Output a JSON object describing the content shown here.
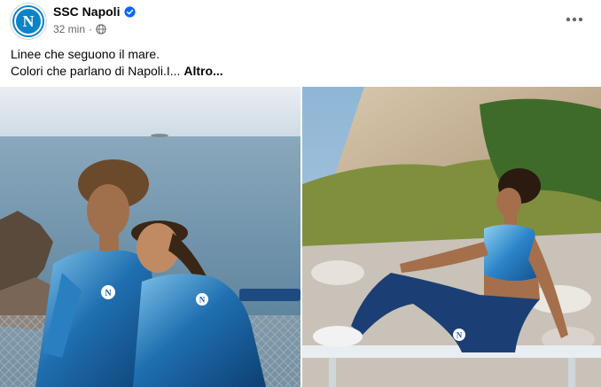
{
  "post": {
    "author": "SSC Napoli",
    "time": "32 min",
    "separator": "·",
    "caption_line1": "Linee che seguono il mare.",
    "caption_line2": "Colori che parlano di Napoli.I...",
    "see_more": "Altro...",
    "logo_letter": "N"
  },
  "icons": {
    "verified": "verified-badge-icon",
    "audience": "globe-icon",
    "more": "more-horizontal-icon"
  },
  "colors": {
    "brand_blue": "#0a84c8",
    "verified_blue": "#0866ff",
    "meta_gray": "#65676b",
    "text": "#050505"
  },
  "photos": [
    {
      "kit_badge": "N"
    },
    {
      "kit_badge": "N"
    }
  ]
}
